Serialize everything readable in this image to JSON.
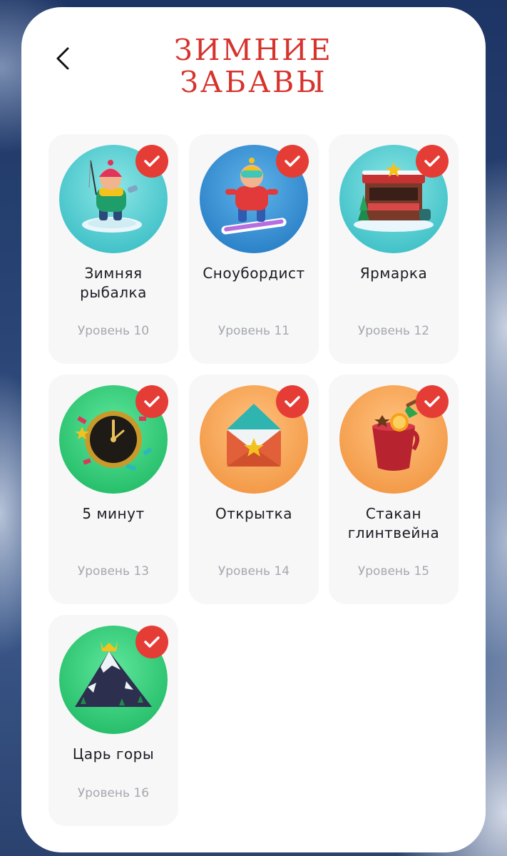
{
  "header": {
    "back_icon": "chevron-left-icon",
    "title_line1": "ЗИМНИЕ",
    "title_line2": "ЗАБАВЫ",
    "accent_color": "#d6332d"
  },
  "achievements": [
    {
      "label_line1": "Зимняя",
      "label_line2": "рыбалка",
      "level": "Уровень 10",
      "icon": "ice-fisher-icon",
      "completed": true,
      "bg": "#5fd0d4"
    },
    {
      "label_line1": "Сноубордист",
      "label_line2": "",
      "level": "Уровень 11",
      "icon": "snowboarder-icon",
      "completed": true,
      "bg": "#3a98d8"
    },
    {
      "label_line1": "Ярмарка",
      "label_line2": "",
      "level": "Уровень 12",
      "icon": "market-stall-icon",
      "completed": true,
      "bg": "#5fd0d4"
    },
    {
      "label_line1": "5 минут",
      "label_line2": "",
      "level": "Уровень 13",
      "icon": "clock-icon",
      "completed": true,
      "bg": "#3ad07e"
    },
    {
      "label_line1": "Открытка",
      "label_line2": "",
      "level": "Уровень 14",
      "icon": "envelope-icon",
      "completed": true,
      "bg": "#f7a85a"
    },
    {
      "label_line1": "Стакан",
      "label_line2": "глинтвейна",
      "level": "Уровень 15",
      "icon": "mulled-wine-icon",
      "completed": true,
      "bg": "#f7a85a"
    },
    {
      "label_line1": "Царь горы",
      "label_line2": "",
      "level": "Уровень 16",
      "icon": "mountain-crown-icon",
      "completed": true,
      "bg": "#3ad07e"
    }
  ]
}
